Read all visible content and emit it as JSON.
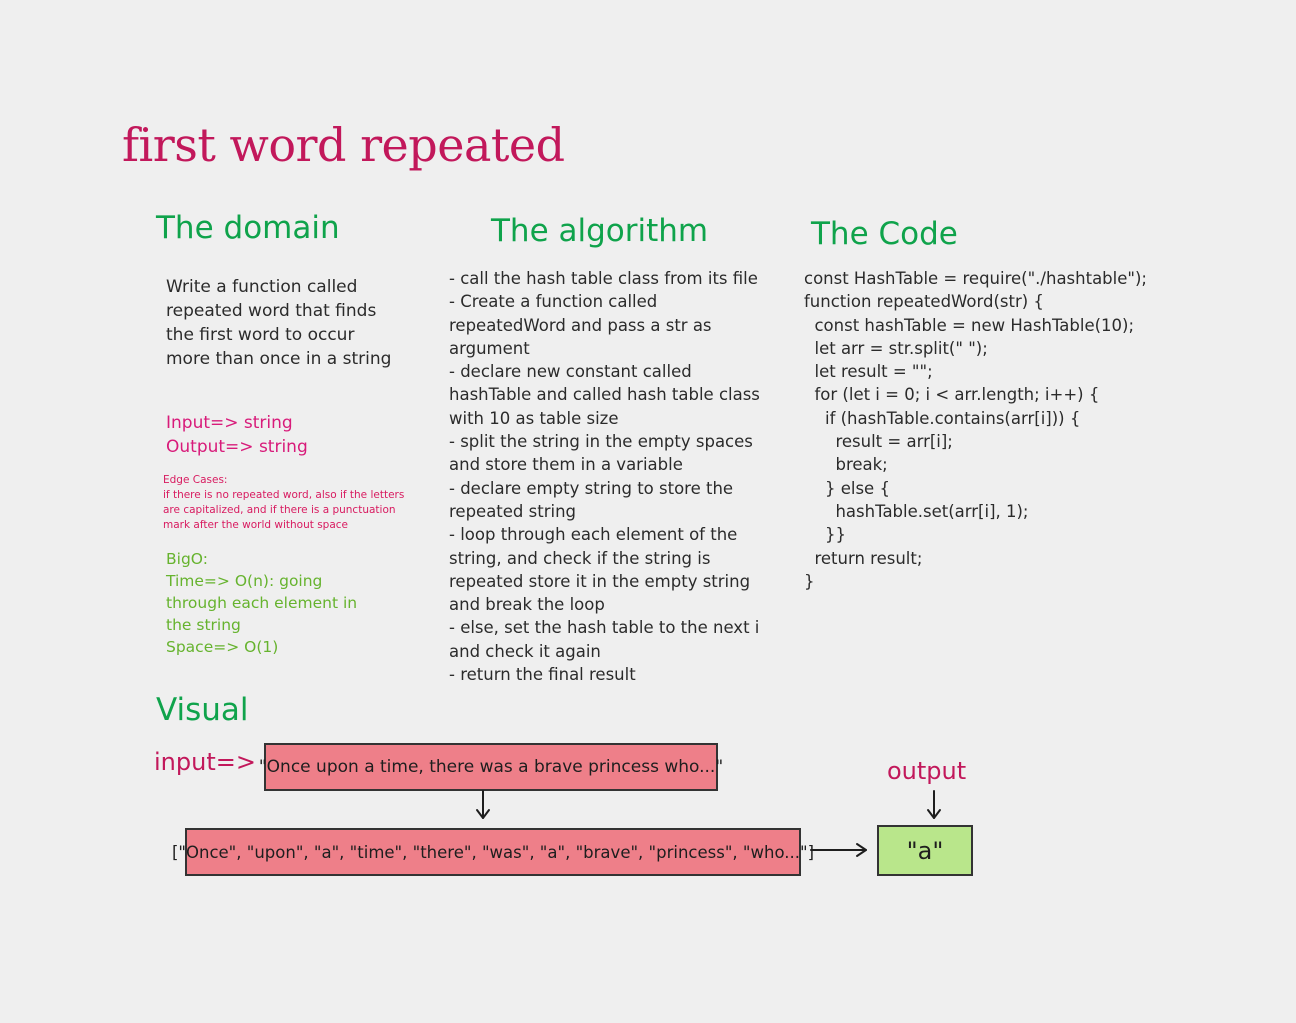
{
  "title": "first word repeated",
  "domain": {
    "heading": "The domain",
    "description": "Write a function called repeated word that finds the first word to occur more than once in a string",
    "input": "Input=> string",
    "output": "Output=> string",
    "edge_title": "Edge Cases:",
    "edge_text": "if there is no repeated word, also if the letters are capitalized, and if there is a punctuation mark after the world without space",
    "bigo_title": "BigO:",
    "bigo_time": "Time=> O(n): going through each element in the string",
    "bigo_space": "Space=> O(1)"
  },
  "algorithm": {
    "heading": "The algorithm",
    "steps": [
      "- call the hash table class from its file",
      "- Create a function called repeatedWord and pass a str as argument",
      "- declare new constant called hashTable and called hash table class with 10 as table size",
      "- split the string in the empty spaces and store them in a variable",
      "- declare empty string to store the repeated string",
      "- loop through each element of the string, and check if the string is repeated store it in the empty string and break the loop",
      "- else, set the hash table to the next i and check it again",
      "- return the final result"
    ]
  },
  "code": {
    "heading": "The Code",
    "lines": [
      "const HashTable = require(\"./hashtable\");",
      "function repeatedWord(str) {",
      "  const hashTable = new HashTable(10);",
      "  let arr = str.split(\" \");",
      "  let result = \"\";",
      "  for (let i = 0; i < arr.length; i++) {",
      "    if (hashTable.contains(arr[i])) {",
      "      result = arr[i];",
      "      break;",
      "    } else {",
      "      hashTable.set(arr[i], 1);",
      "    }}",
      "  return result;",
      "}"
    ]
  },
  "visual": {
    "heading": "Visual",
    "input_label": "input=>",
    "output_label": "output",
    "input_string": "\"Once upon a time, there was a brave princess who...\"",
    "split_array": "[\"Once\", \"upon\", \"a\", \"time\", \"there\", \"was\", \"a\", \"brave\", \"princess\", \"who...\"]",
    "result": "\"a\""
  },
  "colors": {
    "title": "#c2185b",
    "heading": "#0fa34b",
    "io": "#d81b7a",
    "bigo": "#66b32e",
    "box_red": "#ee7f89",
    "box_green": "#b9e68b"
  }
}
